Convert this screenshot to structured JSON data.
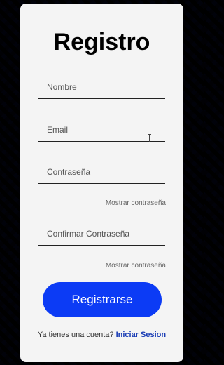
{
  "form": {
    "title": "Registro",
    "fields": {
      "name_placeholder": "Nombre",
      "email_placeholder": "Email",
      "password_placeholder": "Contraseña",
      "confirm_placeholder": "Confirmar Contraseña"
    },
    "show_password_label": "Mostrar contraseña",
    "show_confirm_password_label": "Mostrar contraseña",
    "submit_label": "Registrarse",
    "footer": {
      "prompt": "Ya tienes una cuenta?",
      "login_link": "Iniciar Sesion"
    }
  },
  "colors": {
    "accent": "#0c3bf5",
    "link": "#1a3db5",
    "card_background": "#f4f4f4",
    "page_pattern_primary": "#1f3fff",
    "page_pattern_secondary": "#050505"
  },
  "icons": {
    "text_cursor": "text-cursor-icon"
  }
}
